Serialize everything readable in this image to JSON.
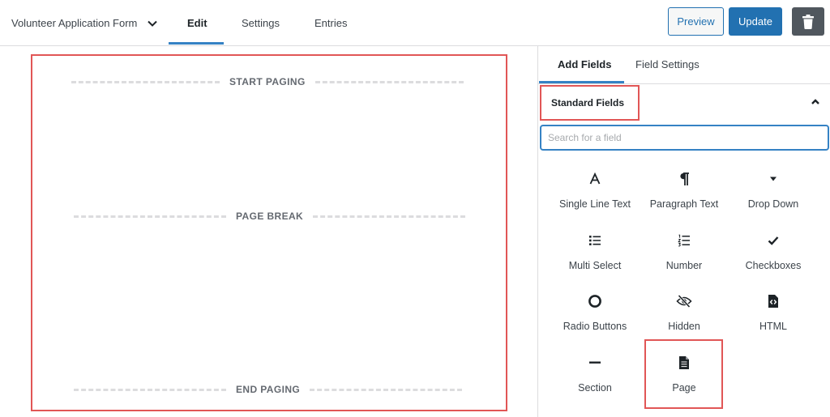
{
  "header": {
    "form_title": "Volunteer Application Form",
    "tabs": [
      {
        "label": "Edit",
        "active": true
      },
      {
        "label": "Settings",
        "active": false
      },
      {
        "label": "Entries",
        "active": false
      }
    ],
    "preview_label": "Preview",
    "update_label": "Update",
    "delete_icon": "trash-icon"
  },
  "canvas": {
    "start_label": "START PAGING",
    "break_label": "PAGE BREAK",
    "end_label": "END PAGING"
  },
  "panel": {
    "tabs": [
      {
        "label": "Add Fields",
        "active": true
      },
      {
        "label": "Field Settings",
        "active": false
      }
    ],
    "section_title": "Standard Fields",
    "search_placeholder": "Search for a field",
    "search_value": "",
    "fields": [
      {
        "label": "Single Line Text",
        "icon": "text-a-icon"
      },
      {
        "label": "Paragraph Text",
        "icon": "pilcrow-icon"
      },
      {
        "label": "Drop Down",
        "icon": "caret-down-icon"
      },
      {
        "label": "Multi Select",
        "icon": "list-icon"
      },
      {
        "label": "Number",
        "icon": "ordered-list-icon"
      },
      {
        "label": "Checkboxes",
        "icon": "checkmark-icon"
      },
      {
        "label": "Radio Buttons",
        "icon": "radio-circle-icon"
      },
      {
        "label": "Hidden",
        "icon": "eye-slash-icon"
      },
      {
        "label": "HTML",
        "icon": "code-file-icon"
      },
      {
        "label": "Section",
        "icon": "minus-icon"
      },
      {
        "label": "Page",
        "icon": "page-icon"
      }
    ]
  },
  "colors": {
    "accent": "#2271b1",
    "highlight": "#e15656",
    "dash": "#dcdcde"
  }
}
